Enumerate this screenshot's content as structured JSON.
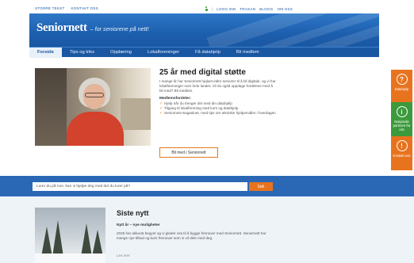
{
  "topbar": {
    "left_links": [
      "STORRE TEKST",
      "KONTAKT OSS"
    ],
    "right_links": [
      "LOGG INN",
      "TRASAN",
      "BLOGG",
      "OM OSS"
    ],
    "separator": "|"
  },
  "header": {
    "logo_name": "Seniornett",
    "tagline": "– for seniorene på nett!"
  },
  "nav": {
    "tabs": [
      "Forside",
      "Tips og triks",
      "Opplæring",
      "Lokalforeninger",
      "Få datahjelp",
      "Bli medlem"
    ],
    "active_index": 0
  },
  "hero": {
    "title": "25 år med digital støtte",
    "intro": "I mange år har Seniornett hjulpet eldre seniorer til å bli digitale, og vi har lokalforeninger over hele landet. Vil du også oppdage fordelene med å bli med? Bli medlem.",
    "subheading": "Medlemsfordeler:",
    "benefits": [
      "Hjelp når du trenger det med din datahjelp",
      "Tilgang til lokalforening med kurs og datahjelp",
      "Seniornett-magasinet, med tips om tekniske hjelpemidler i hverdagen"
    ],
    "cta_label": "Bli med i Seniornett"
  },
  "side": {
    "boxes": [
      {
        "symbol": "?",
        "label": "Datahjelp",
        "color": "#e8731e"
      },
      {
        "symbol": "i",
        "label": "Nasjonale partnere fra oss",
        "color": "#3c9a3c"
      },
      {
        "symbol": "!",
        "label": "Kontakt oss",
        "color": "#e8731e"
      }
    ]
  },
  "search": {
    "placeholder": "Lurer du på noe, kan vi hjelpe deg med det du lurer på?",
    "button_label": "Søk"
  },
  "news": {
    "heading": "Siste nytt",
    "item_title": "Nytt år – nye muligheter",
    "item_body": "2025 har akkurat begynt og vi gleder oss til å bygge fremover med Seniornett. Seniornett har mange nye tilbud og kurs fremover som vi vil dele med deg.",
    "more_label": "Les mer"
  },
  "colors": {
    "brand_blue": "#1a57a2",
    "accent_orange": "#e8731e",
    "accent_green": "#3c9a3c"
  }
}
